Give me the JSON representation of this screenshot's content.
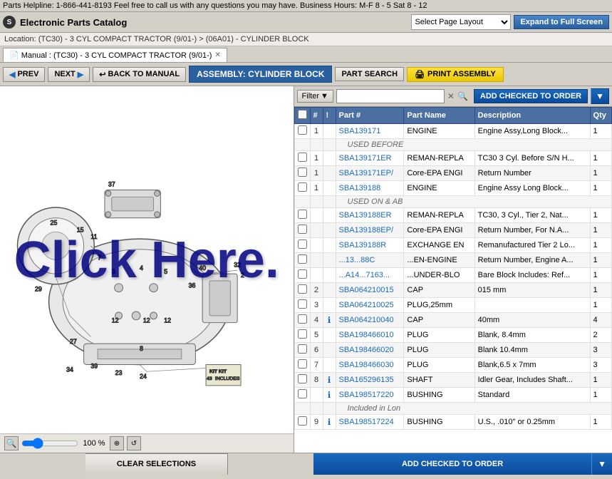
{
  "topbar": {
    "text": "Parts Helpline: 1-866-441-8193  Feel free to call us with any questions you may have.  Business Hours: M-F 8 - 5  Sat 8 - 12"
  },
  "header": {
    "logo_text": "S",
    "title": "Electronic Parts Catalog",
    "page_layout_label": "Select Page Layout",
    "expand_btn": "Expand to Full Screen"
  },
  "breadcrumb": {
    "text": "Location: (TC30) - 3 CYL COMPACT TRACTOR (9/01-) > (06A01) - CYLINDER BLOCK"
  },
  "tabs": [
    {
      "label": "Manual : (TC30) - 3 CYL COMPACT TRACTOR (9/01-)",
      "icon": "manual-icon",
      "active": true,
      "closeable": true
    }
  ],
  "toolbar": {
    "prev_btn": "PREV",
    "next_btn": "NEXT",
    "back_btn": "BACK TO MANUAL",
    "assembly_label": "ASSEMBLY: CYLINDER BLOCK",
    "part_search_btn": "PART SEARCH",
    "print_btn": "PRINT ASSEMBLY"
  },
  "filter": {
    "label": "Filter",
    "placeholder": "",
    "add_checked_btn": "ADD CHECKED TO ORDER"
  },
  "table": {
    "headers": [
      "",
      "#",
      "!",
      "Part #",
      "Part Name",
      "Description",
      "Qty"
    ],
    "rows": [
      {
        "cb": true,
        "num": "1",
        "info": false,
        "part": "SBA139171",
        "name": "ENGINE",
        "desc": "Engine Assy,Long Block...",
        "qty": "1",
        "note": ""
      },
      {
        "cb": false,
        "num": "",
        "info": false,
        "part": "",
        "name": "",
        "desc": "USED BEFORE",
        "qty": "",
        "note": "note-row"
      },
      {
        "cb": true,
        "num": "1",
        "info": false,
        "part": "SBA139171ER",
        "name": "REMAN-REPLA",
        "desc": "TC30 3 Cyl. Before S/N H...",
        "qty": "1",
        "note": ""
      },
      {
        "cb": true,
        "num": "1",
        "info": false,
        "part": "SBA139171EP/",
        "name": "Core-EPA ENGI",
        "desc": "Return Number",
        "qty": "1",
        "note": ""
      },
      {
        "cb": true,
        "num": "1",
        "info": false,
        "part": "SBA139188",
        "name": "ENGINE",
        "desc": "Engine Assy Long Block...",
        "qty": "1",
        "note": ""
      },
      {
        "cb": false,
        "num": "",
        "info": false,
        "part": "",
        "name": "",
        "desc": "USED ON & AB",
        "qty": "",
        "note": "note-row"
      },
      {
        "cb": true,
        "num": "",
        "info": false,
        "part": "SBA139188ER",
        "name": "REMAN-REPLA",
        "desc": "TC30, 3 Cyl., Tier 2, Nat...",
        "qty": "1",
        "note": ""
      },
      {
        "cb": true,
        "num": "",
        "info": false,
        "part": "SBA139188EP/",
        "name": "Core-EPA ENGI",
        "desc": "Return Number, For N.A...",
        "qty": "1",
        "note": ""
      },
      {
        "cb": true,
        "num": "",
        "info": false,
        "part": "SBA139188R",
        "name": "EXCHANGE EN",
        "desc": "Remanufactured Tier 2 Lo...",
        "qty": "1",
        "note": ""
      },
      {
        "cb": true,
        "num": "",
        "info": false,
        "part": "...13...88C",
        "name": "...EN-ENGINE",
        "desc": "Return Number, Engine A...",
        "qty": "1",
        "note": ""
      },
      {
        "cb": true,
        "num": "",
        "info": false,
        "part": "...A14...7163...",
        "name": "...UNDER-BLO",
        "desc": "Bare Block Includes: Ref...",
        "qty": "1",
        "note": ""
      },
      {
        "cb": true,
        "num": "2",
        "info": false,
        "part": "SBA064210015",
        "name": "CAP",
        "desc": "015 mm",
        "qty": "1",
        "note": ""
      },
      {
        "cb": true,
        "num": "3",
        "info": false,
        "part": "SBA064210025",
        "name": "PLUG,25mm",
        "desc": "",
        "qty": "1",
        "note": ""
      },
      {
        "cb": true,
        "num": "4",
        "info": true,
        "part": "SBA064210040",
        "name": "CAP",
        "desc": "40mm",
        "qty": "4",
        "note": ""
      },
      {
        "cb": true,
        "num": "5",
        "info": false,
        "part": "SBA198466010",
        "name": "PLUG",
        "desc": "Blank, 8.4mm",
        "qty": "2",
        "note": ""
      },
      {
        "cb": true,
        "num": "6",
        "info": false,
        "part": "SBA198466020",
        "name": "PLUG",
        "desc": "Blank 10.4mm",
        "qty": "3",
        "note": ""
      },
      {
        "cb": true,
        "num": "7",
        "info": false,
        "part": "SBA198466030",
        "name": "PLUG",
        "desc": "Blank,6.5 x 7mm",
        "qty": "3",
        "note": ""
      },
      {
        "cb": true,
        "num": "8",
        "info": true,
        "part": "SBA165296135",
        "name": "SHAFT",
        "desc": "Idler Gear, Includes Shaft...",
        "qty": "1",
        "note": ""
      },
      {
        "cb": true,
        "num": "",
        "info": true,
        "part": "SBA198517220",
        "name": "BUSHING",
        "desc": "Standard",
        "qty": "1",
        "note": ""
      },
      {
        "cb": false,
        "num": "",
        "info": false,
        "part": "",
        "name": "",
        "desc": "Included in Lon",
        "qty": "",
        "note": "note-row"
      },
      {
        "cb": true,
        "num": "9",
        "info": true,
        "part": "SBA198517224",
        "name": "BUSHING",
        "desc": "U.S., .010\" or 0.25mm",
        "qty": "1",
        "note": ""
      }
    ]
  },
  "zoom": {
    "level": "100 %"
  },
  "bottom_bar": {
    "clear_btn": "CLEAR SELECTIONS",
    "add_order_btn": "ADD CHECKED TO ORDER"
  },
  "diagram": {
    "click_text": "Click Here."
  }
}
